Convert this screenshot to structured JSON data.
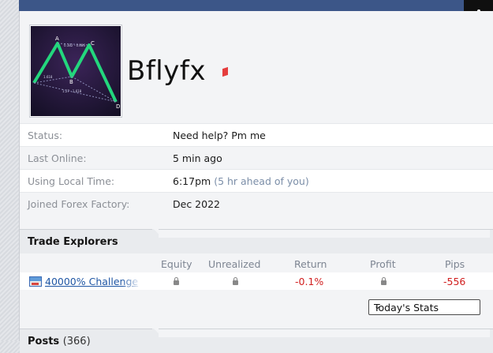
{
  "profile": {
    "username": "Bflyfx",
    "avatar_icon": "butterfly-harmonic-pattern-chart",
    "avatar_labels": [
      "A",
      "B",
      "C",
      "D",
      "0.382 - 0.886",
      "1.618",
      "1.27 - 1.618"
    ]
  },
  "info_rows": [
    {
      "label": "Status:",
      "value": "Need help? Pm me",
      "extra": ""
    },
    {
      "label": "Last Online:",
      "value": "5 min ago",
      "extra": ""
    },
    {
      "label": "Using Local Time:",
      "value": "6:17pm",
      "extra": "(5 hr ahead of you)"
    },
    {
      "label": "Joined Forex Factory:",
      "value": "Dec 2022",
      "extra": ""
    }
  ],
  "trade_explorers": {
    "title": "Trade Explorers",
    "columns": [
      "Equity",
      "Unrealized",
      "Return",
      "Profit",
      "Pips"
    ],
    "row": {
      "name": "40000% Challenge",
      "return": "-0.1%",
      "pips": "-556"
    },
    "stats_select": "Today's Stats"
  },
  "posts": {
    "title": "Posts",
    "count": "(366)"
  },
  "colors": {
    "topbar": "#3c5688",
    "link": "#1f56a4",
    "negative": "#d11f1f",
    "flag": "#e53d3d"
  }
}
